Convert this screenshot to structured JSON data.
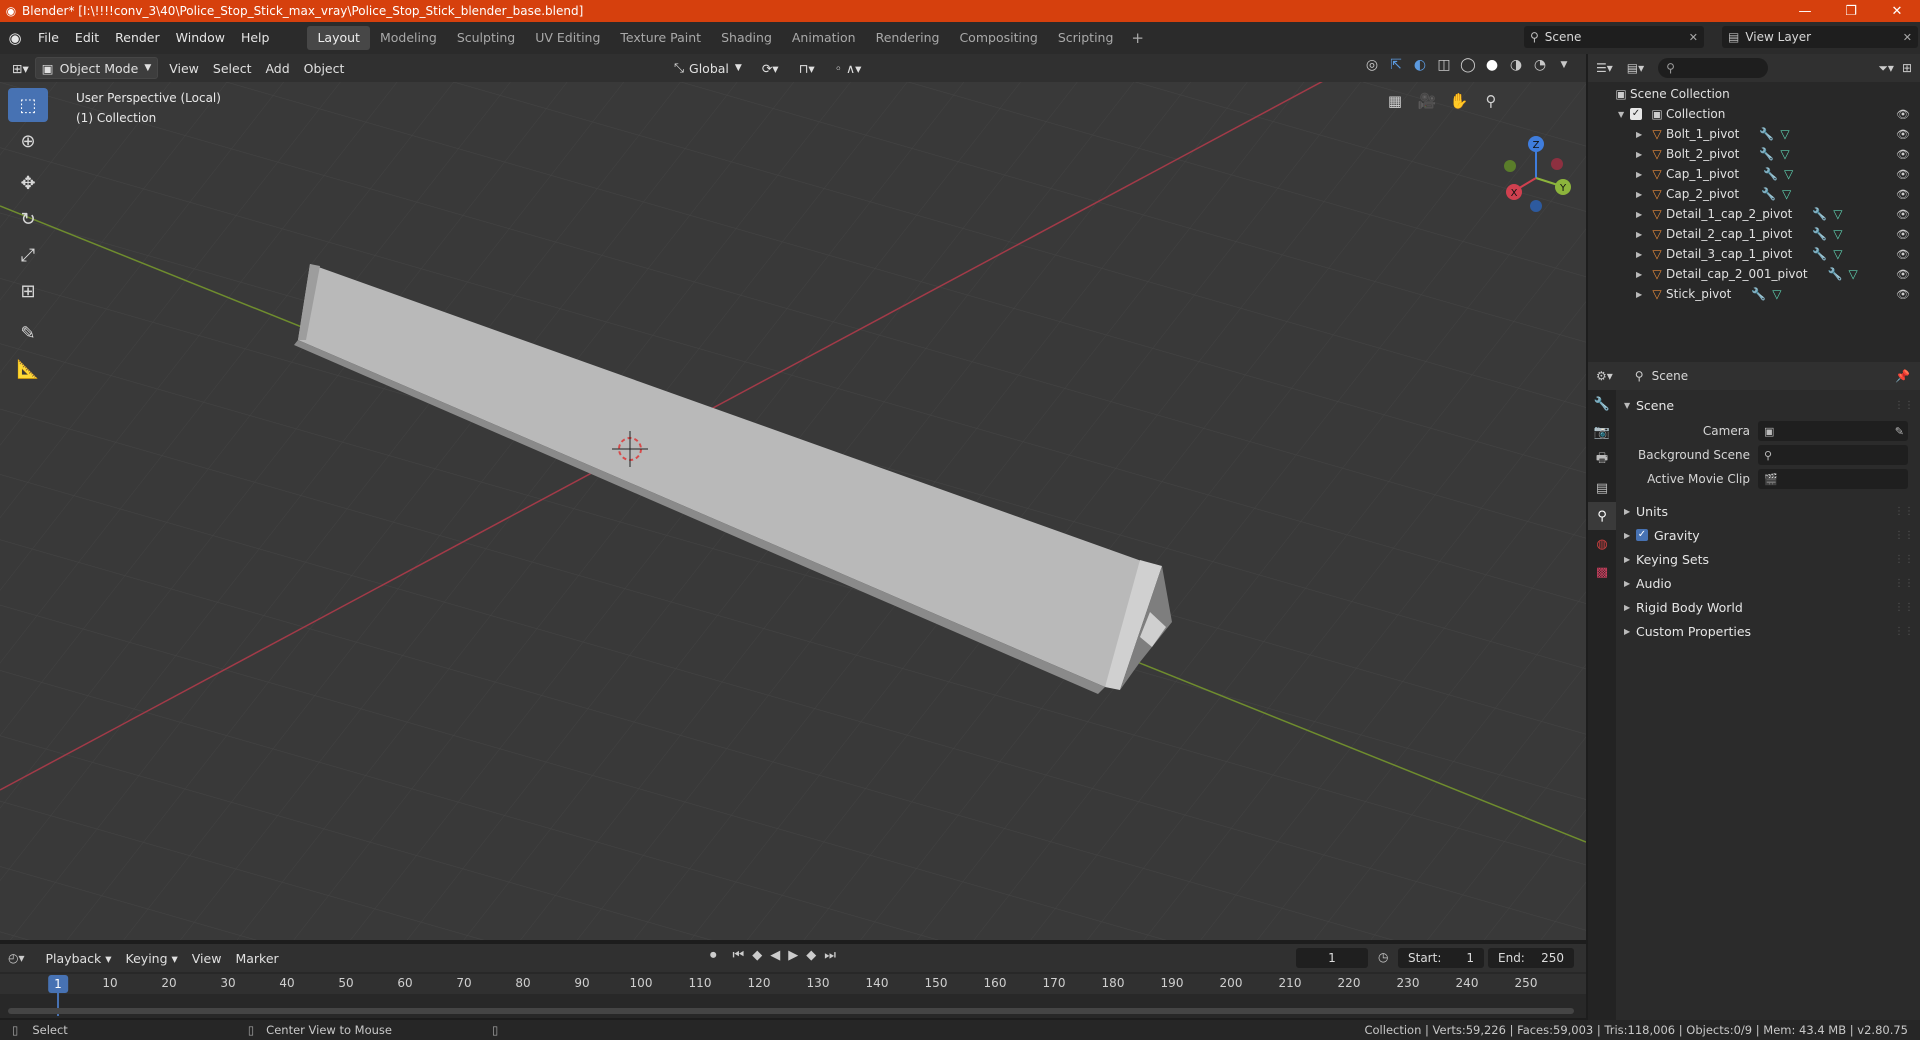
{
  "window": {
    "title": "Blender* [I:\\!!!!conv_3\\40\\Police_Stop_Stick_max_vray\\Police_Stop_Stick_blender_base.blend]",
    "minimize": "—",
    "maximize": "❐",
    "close": "✕"
  },
  "menu": {
    "file": "File",
    "edit": "Edit",
    "render": "Render",
    "window": "Window",
    "help": "Help"
  },
  "workspaces": [
    "Layout",
    "Modeling",
    "Sculpting",
    "UV Editing",
    "Texture Paint",
    "Shading",
    "Animation",
    "Rendering",
    "Compositing",
    "Scripting"
  ],
  "scene_selector": "Scene",
  "view_layer_selector": "View Layer",
  "viewport_header": {
    "mode": "Object Mode",
    "view": "View",
    "select": "Select",
    "add": "Add",
    "object": "Object",
    "orientation": "Global"
  },
  "viewport": {
    "perspective": "User Perspective (Local)",
    "collection": "(1) Collection",
    "gizmo": {
      "z": "Z",
      "y": "Y",
      "x": "X"
    }
  },
  "outliner": {
    "scene_collection": "Scene Collection",
    "collection": "Collection",
    "objects": [
      "Bolt_1_pivot",
      "Bolt_2_pivot",
      "Cap_1_pivot",
      "Cap_2_pivot",
      "Detail_1_cap_2_pivot",
      "Detail_2_cap_1_pivot",
      "Detail_3_cap_1_pivot",
      "Detail_cap_2_001_pivot",
      "Stick_pivot"
    ]
  },
  "properties": {
    "header": "Scene",
    "panel": "Scene",
    "camera_label": "Camera",
    "background_scene_label": "Background Scene",
    "active_movie_clip_label": "Active Movie Clip",
    "sections": [
      "Units",
      "Gravity",
      "Keying Sets",
      "Audio",
      "Rigid Body World",
      "Custom Properties"
    ],
    "gravity_checked": true
  },
  "timeline": {
    "playback": "Playback",
    "keying": "Keying",
    "view": "View",
    "marker": "Marker",
    "current_frame": "1",
    "start_label": "Start:",
    "start": "1",
    "end_label": "End:",
    "end": "250",
    "ruler": [
      "10",
      "20",
      "30",
      "40",
      "50",
      "60",
      "70",
      "80",
      "90",
      "100",
      "110",
      "120",
      "130",
      "140",
      "150",
      "160",
      "170",
      "180",
      "190",
      "200",
      "210",
      "220",
      "230",
      "240",
      "250"
    ],
    "cursor": "1"
  },
  "statusbar": {
    "select": "Select",
    "center_view": "Center View to Mouse",
    "stats": "Collection | Verts:59,226 | Faces:59,003 | Tris:118,006 | Objects:0/9 | Mem: 43.4 MB | v2.80.75"
  },
  "colors": {
    "title_bar": "#d6400d",
    "accent": "#4772b3",
    "object_icon": "#e48a3c",
    "x_axis": "#c94052",
    "y_axis": "#8cb43c"
  }
}
